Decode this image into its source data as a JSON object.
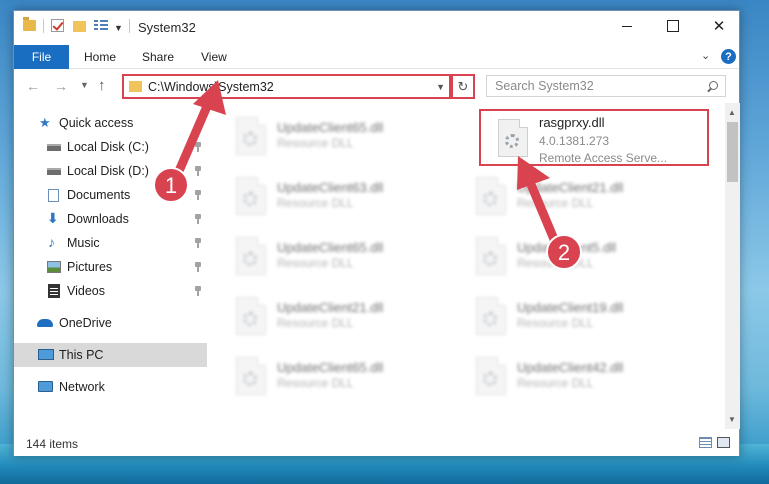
{
  "window": {
    "title": "System32",
    "controls": {
      "minimize": "minimize",
      "maximize": "maximize",
      "close": "✕"
    }
  },
  "ribbon": {
    "tabs": [
      "File",
      "Home",
      "Share",
      "View"
    ],
    "help": "?"
  },
  "navigation": {
    "address": "C:\\Windows\\System32",
    "search_placeholder": "Search System32"
  },
  "sidebar": {
    "items": [
      {
        "label": "Quick access",
        "icon": "star-icon"
      },
      {
        "label": "Local Disk (C:)",
        "icon": "drive-icon",
        "pinned": true
      },
      {
        "label": "Local Disk (D:)",
        "icon": "drive-icon",
        "pinned": true
      },
      {
        "label": "Documents",
        "icon": "documents-icon",
        "pinned": true
      },
      {
        "label": "Downloads",
        "icon": "downloads-icon",
        "pinned": true
      },
      {
        "label": "Music",
        "icon": "music-icon",
        "pinned": true
      },
      {
        "label": "Pictures",
        "icon": "pictures-icon",
        "pinned": true
      },
      {
        "label": "Videos",
        "icon": "videos-icon",
        "pinned": true
      },
      {
        "label": "OneDrive",
        "icon": "cloud-icon"
      },
      {
        "label": "This PC",
        "icon": "computer-icon",
        "selected": true
      },
      {
        "label": "Network",
        "icon": "network-icon"
      }
    ]
  },
  "files": {
    "highlighted": {
      "name": "rasgprxy.dll",
      "version": "4.0.1381.273",
      "description": "Remote Access Serve..."
    },
    "left_column": [
      {
        "name": "UpdateClient65.dll",
        "type": "Resource DLL"
      },
      {
        "name": "UpdateClient63.dll",
        "type": "Resource DLL"
      },
      {
        "name": "UpdateClient65.dll",
        "type": "Resource DLL"
      },
      {
        "name": "UpdateClient21.dll",
        "type": "Resource DLL"
      },
      {
        "name": "UpdateClient65.dll",
        "type": "Resource DLL"
      }
    ],
    "right_column": [
      {
        "name": "UpdateClient21.dll",
        "type": "Resource DLL"
      },
      {
        "name": "UpdateClient5.dll",
        "type": "Resource DLL"
      },
      {
        "name": "UpdateClient19.dll",
        "type": "Resource DLL"
      },
      {
        "name": "UpdateClient42.dll",
        "type": "Resource DLL"
      }
    ]
  },
  "status": {
    "item_count": "144 items"
  },
  "annotations": {
    "step1": "1",
    "step2": "2"
  },
  "colors": {
    "accent": "#1a6ec2",
    "annotation_red": "#d9434f"
  }
}
